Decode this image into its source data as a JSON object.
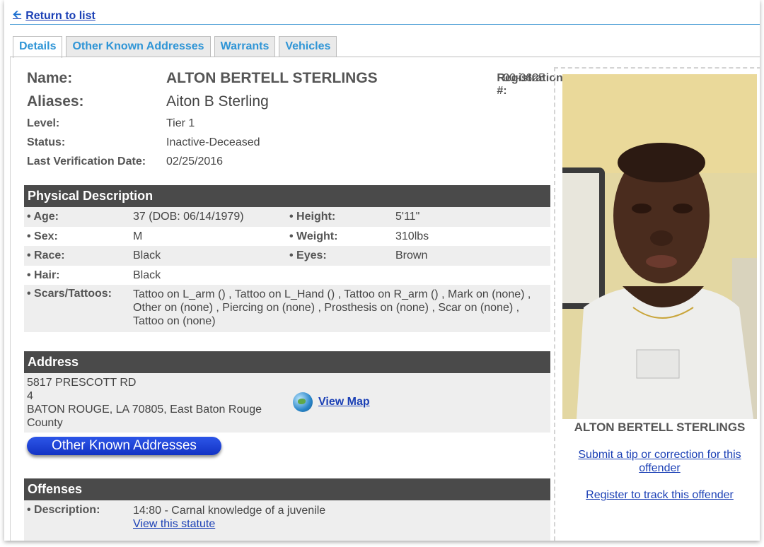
{
  "nav": {
    "return_label": "Return to list"
  },
  "tabs": [
    "Details",
    "Other Known Addresses",
    "Warrants",
    "Vehicles"
  ],
  "details": {
    "name_label": "Name:",
    "name": "ALTON BERTELL STERLINGS",
    "registration_label": "Registration #:",
    "registration": "00-0625",
    "aliases_label": "Aliases:",
    "aliases": "Aiton B Sterling",
    "level_label": "Level:",
    "level": "Tier 1",
    "status_label": "Status:",
    "status": "Inactive-Deceased",
    "verification_label": "Last Verification Date:",
    "verification": "02/25/2016"
  },
  "physical": {
    "title": "Physical Description",
    "age_label": "• Age:",
    "age": "37  (DOB: 06/14/1979)",
    "height_label": "• Height:",
    "height": "5'11\"",
    "sex_label": "• Sex:",
    "sex": "M",
    "weight_label": "• Weight:",
    "weight": "310lbs",
    "race_label": "• Race:",
    "race": "Black",
    "eyes_label": "• Eyes:",
    "eyes": "Brown",
    "hair_label": "• Hair:",
    "hair": "Black",
    "scars_label": "• Scars/Tattoos:",
    "scars": "Tattoo on L_arm () , Tattoo on L_Hand () , Tattoo on R_arm () , Mark on (none) , Other on (none) , Piercing on (none) , Prosthesis on (none) , Scar on (none) , Tattoo on (none)"
  },
  "address": {
    "title": "Address",
    "line1": "5817 PRESCOTT RD",
    "line2": "4",
    "line3": "BATON ROUGE, LA 70805, East Baton Rouge County",
    "map_label": "View Map",
    "map_icon": "globe-icon",
    "other_button": "Other Known Addresses"
  },
  "offenses": {
    "title": "Offenses",
    "desc_label": "• Description:",
    "description": "14:80 - Carnal knowledge of a juvenile",
    "statute_link": "View this statute"
  },
  "sidebar": {
    "name": "ALTON BERTELL STERLINGS",
    "tip_link": "Submit a tip or correction for this offender",
    "register_link": "Register to track this offender"
  },
  "colors": {
    "link": "#1a3fb5",
    "tab_text": "#2f95d6",
    "section_header": "#4a4a4a",
    "row_shade": "#eeeeee",
    "button": "#1a3fd0"
  }
}
